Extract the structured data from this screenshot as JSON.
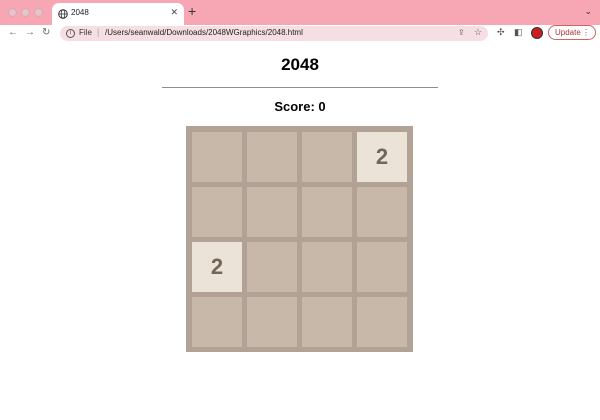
{
  "browser": {
    "tab": {
      "title": "2048",
      "icon": "globe-icon"
    },
    "new_tab_symbol": "+",
    "tabs_menu_symbol": "⌄",
    "nav": {
      "back": "←",
      "forward": "→",
      "reload": "↻"
    },
    "address": {
      "scheme_label": "File",
      "url": "/Users/seanwald/Downloads/2048WGraphics/2048.html"
    },
    "update_label": "Update",
    "colors": {
      "chrome": "#f7a6b3",
      "omnibox": "#f5dfe3"
    }
  },
  "page": {
    "title": "2048",
    "score_label": "Score: 0",
    "board": [
      [
        "",
        "",
        "",
        "2"
      ],
      [
        "",
        "",
        "",
        ""
      ],
      [
        "2",
        "",
        "",
        ""
      ],
      [
        "",
        "",
        "",
        ""
      ]
    ],
    "colors": {
      "board": "#b2a295",
      "empty_cell": "#c7b8a9",
      "tile_2": "#ece3d8",
      "tile_text": "#736658"
    }
  }
}
